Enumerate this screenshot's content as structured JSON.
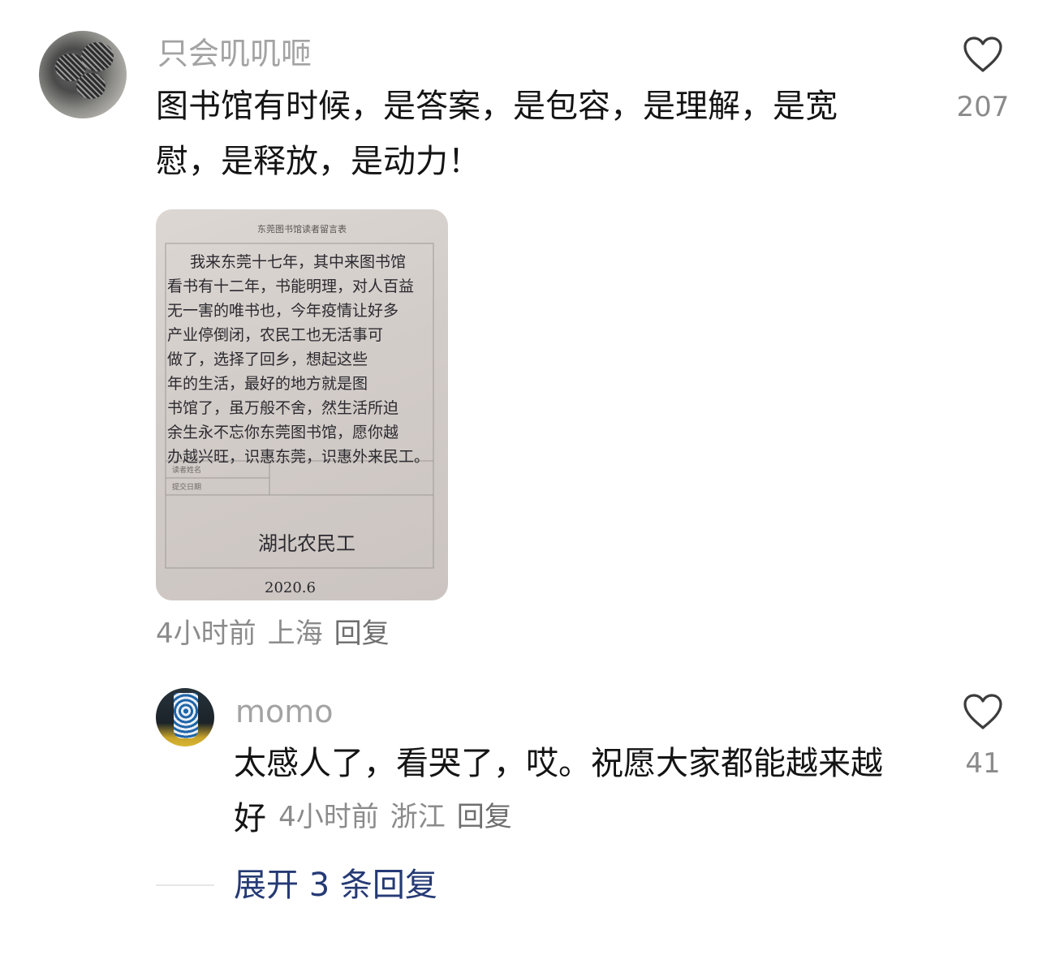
{
  "comment": {
    "username": "只会叽叽咂",
    "text": "图书馆有时候，是答案，是包容，是理解，是宽慰，是释放，是动力！",
    "time": "4小时前",
    "location": "上海",
    "reply_label": "回复",
    "like_count": "207",
    "attachment": {
      "form_title": "东莞图书馆读者留言表",
      "handwritten_lines": [
        "我来东莞十七年，其中来图书馆",
        "看书有十二年，书能明理，对人百益",
        "无一害的唯书也，今年疫情让好多",
        "产业停倒闭，农民工也无活事可",
        "做了，选择了回乡，想起这些",
        "年的生活，最好的地方就是图",
        "书馆了，虽万般不舍，然生活所迫",
        "余生永不忘你东莞图书馆，愿你越",
        "办越兴旺，识惠东莞，识惠外来民工。"
      ],
      "form_labels": [
        "读者姓名",
        "提交日期"
      ],
      "signature": "湖北农民工",
      "date": "2020.6"
    }
  },
  "reply": {
    "username": "momo",
    "text_line1": "太感人了，看哭了，哎。祝愿大家都能越来越",
    "text_line2": "好",
    "time": "4小时前",
    "location": "浙江",
    "reply_label": "回复",
    "like_count": "41"
  },
  "expand": {
    "label": "展开 3 条回复"
  },
  "icons": {
    "like": "heart-outline-icon"
  },
  "colors": {
    "username": "#a3a3a3",
    "meta": "#8b8b8b",
    "expand_link": "#253a75"
  }
}
